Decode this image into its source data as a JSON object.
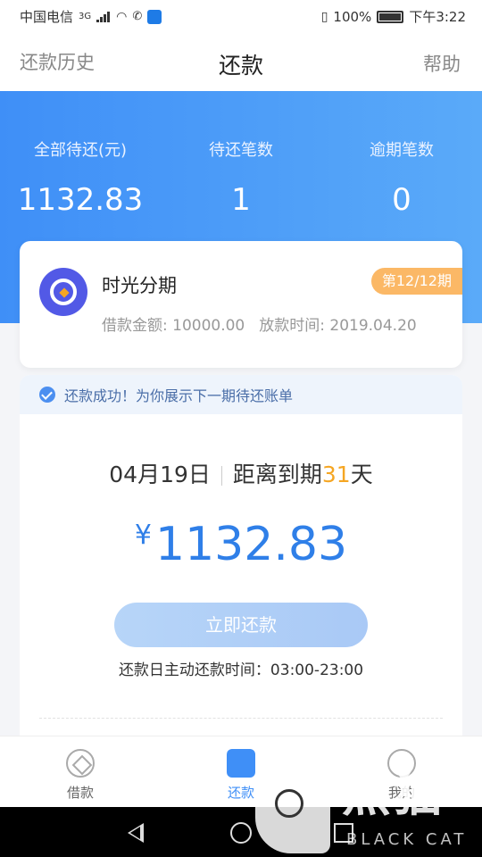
{
  "status_bar": {
    "carrier": "中国电信",
    "network": "3G",
    "battery_pct": "100%",
    "time": "下午3:22"
  },
  "header": {
    "left_link": "还款历史",
    "title": "还款",
    "right_link": "帮助"
  },
  "summary": {
    "total_label": "全部待还(元)",
    "total_value": "1132.83",
    "count_label": "待还笔数",
    "count_value": "1",
    "overdue_label": "逾期笔数",
    "overdue_value": "0"
  },
  "loan_card": {
    "product_name": "时光分期",
    "period_badge": "第12/12期",
    "amount_text": "借款金额: 10000.00",
    "date_text": "放款时间: 2019.04.20"
  },
  "bill": {
    "notice": "还款成功！为你展示下一期待还账单",
    "due_date": "04月19日",
    "countdown_prefix": "距离到期",
    "countdown_days": "31",
    "countdown_suffix": "天",
    "currency": "¥",
    "amount": "1132.83",
    "pay_button": "立即还款",
    "pay_time": "还款日主动还款时间：03:00-23:00"
  },
  "bottom_nav": {
    "items": [
      {
        "label": "借款",
        "icon": "loan-icon"
      },
      {
        "label": "还款",
        "icon": "repay-icon"
      },
      {
        "label": "我的",
        "icon": "profile-icon"
      }
    ]
  },
  "watermark": {
    "cn": "黑猫",
    "en": "BLACK CAT"
  },
  "colors": {
    "accent": "#3f8ff7",
    "badge": "#fbb866",
    "countdown": "#f5a623"
  }
}
